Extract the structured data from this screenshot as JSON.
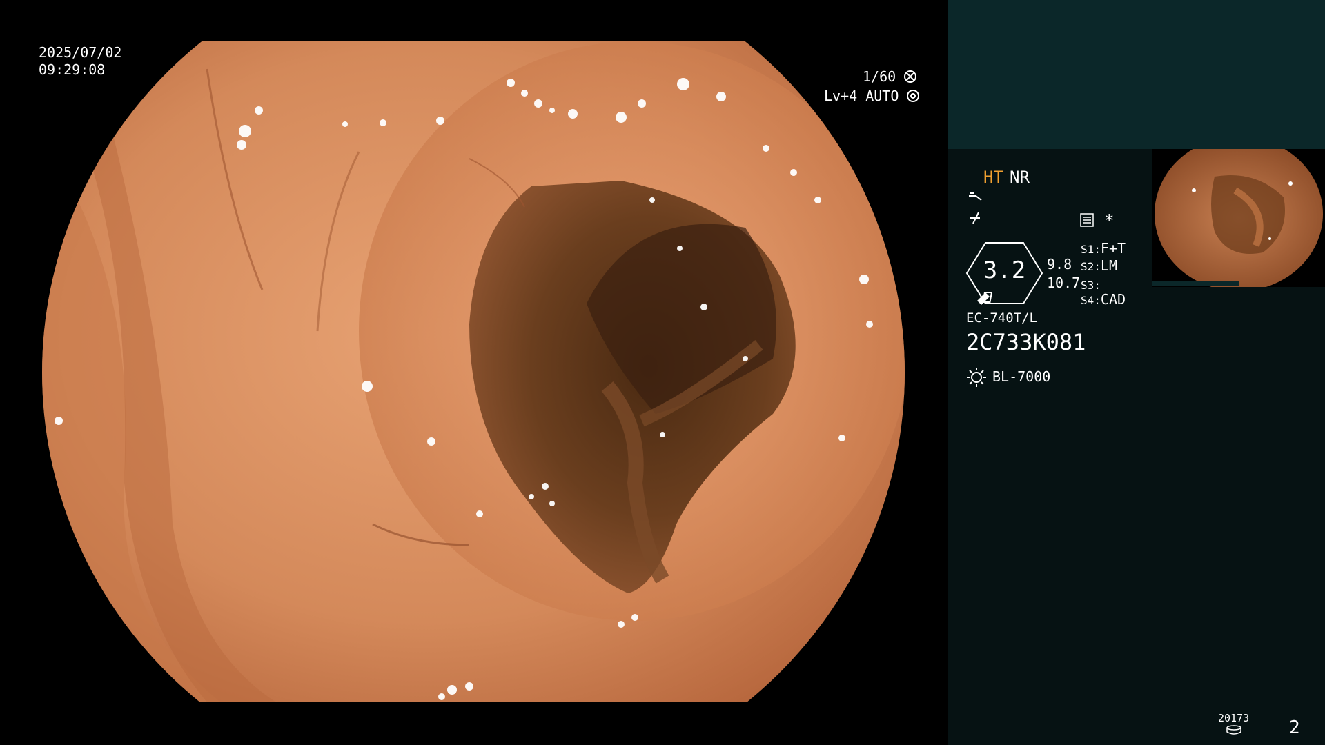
{
  "overlay": {
    "date": "2025/07/02",
    "time": "09:29:08",
    "shutter": "1/60",
    "shutter_icon": "shutter-icon",
    "level": "Lv+4",
    "mode": "AUTO",
    "mode_icon": "auto-exposure-icon"
  },
  "status": {
    "ht": "HT",
    "nr": "NR",
    "ht_color": "#f0a030",
    "icon1": "scope-tip-icon",
    "icon2": "flex-icon",
    "settings_icon": "settings-list-icon",
    "asterisk": "*",
    "zoom": "3.2",
    "val1": "9.8",
    "val2": "10.7",
    "s1_label": "S1:",
    "s1_value": "F+T",
    "s2_label": "S2:",
    "s2_value": "LM",
    "s3_label": "S3:",
    "s3_value": "",
    "s4_label": "S4:",
    "s4_value": "CAD"
  },
  "device": {
    "model": "EC-740T/L",
    "serial": "2C733K081",
    "light_icon": "light-source-icon",
    "light_source": "BL-7000"
  },
  "footer": {
    "counter": "20173",
    "counter_icon": "storage-icon",
    "page": "2"
  },
  "colors": {
    "panel_bg": "#061213",
    "panel_top_bg": "#0b2729",
    "mucosa": "#d98a5a",
    "lumen": "#3a2414"
  }
}
